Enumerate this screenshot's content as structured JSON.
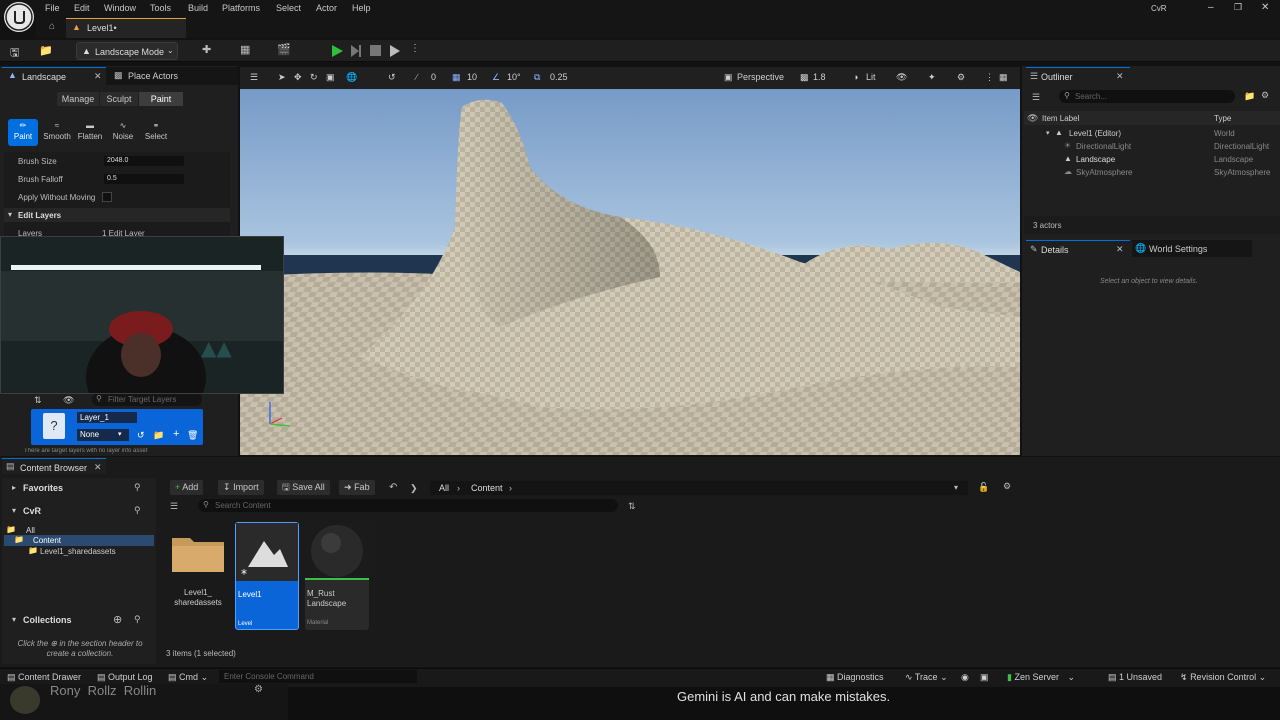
{
  "menu": {
    "items": [
      "File",
      "Edit",
      "Window",
      "Tools",
      "Build",
      "Platforms",
      "Select",
      "Actor",
      "Help"
    ],
    "user": "CvR"
  },
  "level_tab": "Level1•",
  "toolbar": {
    "mode": "Landscape Mode"
  },
  "landscape_panel": {
    "tab": "Landscape",
    "place_actors_tab": "Place Actors",
    "modes": [
      "Manage",
      "Sculpt",
      "Paint"
    ],
    "active_mode": "Paint",
    "tools": [
      "Paint",
      "Smooth",
      "Flatten",
      "Noise",
      "Select"
    ],
    "brush_size_label": "Brush Size",
    "brush_size": "2048.0",
    "brush_falloff_label": "Brush Falloff",
    "brush_falloff": "0.5",
    "apply_without_moving": "Apply Without Moving",
    "edit_layers": "Edit Layers",
    "layers_label": "Layers",
    "layers_value": "1 Edit Layer",
    "filter_placeholder": "Filter Target Layers",
    "layer_name": "Layer_1",
    "layer_select": "None",
    "layer_note": "There are target layers with no layer info asset"
  },
  "viewport": {
    "perspective": "Perspective",
    "speed": "1.8",
    "lit": "Lit",
    "rot_snap": "10°",
    "loc_snap": "10",
    "angle": "0",
    "scale_snap": "0.25"
  },
  "outliner": {
    "title": "Outliner",
    "search_placeholder": "Search...",
    "col_label": "Item Label",
    "col_type": "Type",
    "rows": [
      {
        "label": "Level1 (Editor)",
        "type": "World"
      },
      {
        "label": "DirectionalLight",
        "type": "DirectionalLight"
      },
      {
        "label": "Landscape",
        "type": "Landscape"
      },
      {
        "label": "SkyAtmosphere",
        "type": "SkyAtmosphere"
      }
    ],
    "count": "3 actors"
  },
  "details": {
    "title": "Details",
    "world_settings": "World Settings",
    "empty_msg": "Select an object to view details."
  },
  "content_browser": {
    "title": "Content Browser",
    "add": "Add",
    "import": "Import",
    "save_all": "Save All",
    "fab": "Fab",
    "path_all": "All",
    "path_content": "Content",
    "search_placeholder": "Search Content",
    "favorites": "Favorites",
    "project": "CvR",
    "tree_all": "All",
    "tree_content": "Content",
    "tree_shared": "Level1_sharedassets",
    "collections": "Collections",
    "collections_hint_1": "Click the",
    "collections_hint_2": "in the section header to",
    "collections_hint_3": "create a collection.",
    "assets": [
      {
        "name": "Level1_ sharedassets",
        "type": ""
      },
      {
        "name": "Level1",
        "type": "Level"
      },
      {
        "name": "M_Rust Landscape",
        "type": "Material"
      }
    ],
    "items_count": "3 items (1 selected)"
  },
  "statusbar": {
    "content_drawer": "Content Drawer",
    "output_log": "Output Log",
    "cmd": "Cmd",
    "console_placeholder": "Enter Console Command",
    "diagnostics": "Diagnostics",
    "trace": "Trace",
    "zen_server": "Zen Server",
    "unsaved": "1 Unsaved",
    "revision_control": "Revision Control"
  },
  "overlay": {
    "gemini_notice": "Gemini is AI and can make mistakes.",
    "stream_names": "Rony  Rollz  Rollin"
  },
  "colors": {
    "accent": "#0070e0",
    "play": "#2fbf3a",
    "level_tab": "#e8a23b"
  }
}
